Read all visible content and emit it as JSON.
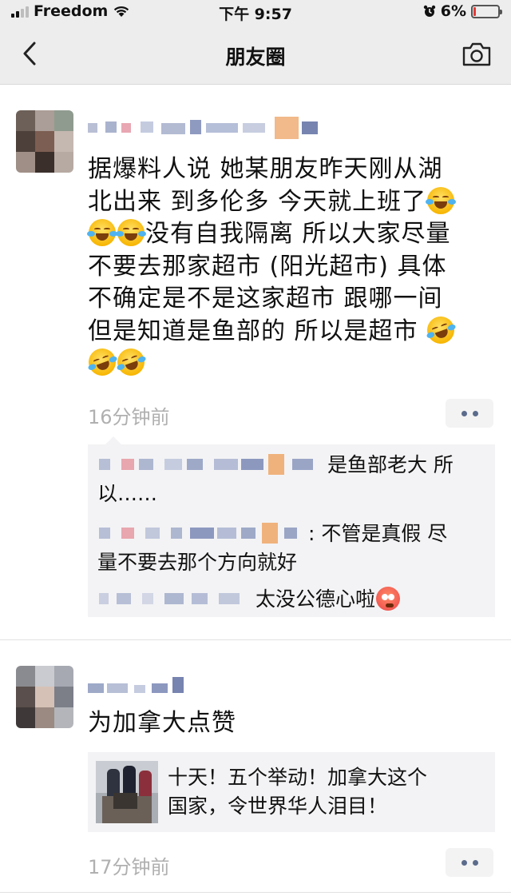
{
  "status_bar": {
    "carrier": "Freedom",
    "time": "下午 9:57",
    "battery": "6%"
  },
  "nav": {
    "title": "朋友圈"
  },
  "posts": [
    {
      "text_lines": [
        "据爆料人说 她某朋友昨天刚从湖",
        "北出来 到多伦多 今天就上班了",
        "没有自我隔离 所以大家尽量",
        "不要去那家超市 (阳光超市) 具体",
        "不确定是不是这家超市 跟哪一间",
        "但是知道是鱼部的 所以是超市"
      ],
      "time": "16分钟前",
      "comments": [
        {
          "text": "是鱼部老大 所",
          "cont": "以……"
        },
        {
          "text": ": 不管是真假 尽",
          "cont": "量不要去那个方向就好"
        },
        {
          "text": "太没公德心啦"
        }
      ]
    },
    {
      "text": "为加拿大点赞",
      "link": {
        "title": "十天！五个举动！加拿大这个国家，令世界华人泪目！",
        "line1": "十天！五个举动！加拿大这个",
        "line2": "国家，令世界华人泪目！"
      },
      "time": "17分钟前"
    }
  ],
  "icons": {
    "back": "chevron-left-icon",
    "camera": "camera-icon",
    "more": "more-dots-icon"
  },
  "colors": {
    "nav_bg": "#ededed",
    "comment_bg": "#f3f3f5",
    "time_gray": "#b0b0b0",
    "dots": "#5b6b8c"
  }
}
